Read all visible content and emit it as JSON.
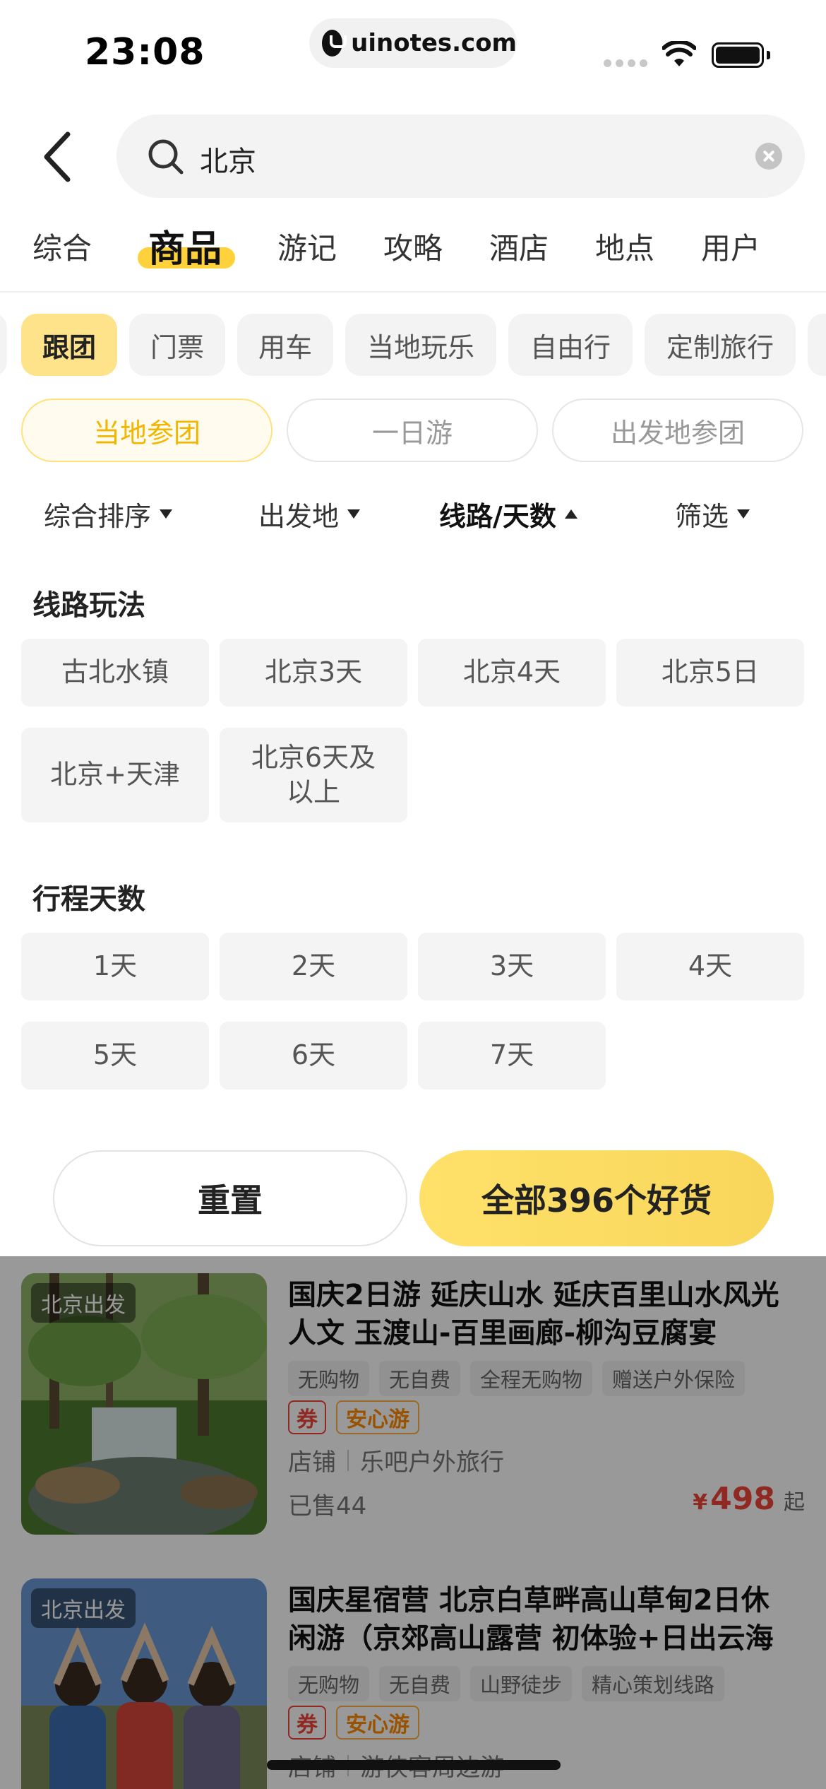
{
  "status_bar": {
    "time": "23:08",
    "url": "uinotes.com"
  },
  "search": {
    "value": "北京"
  },
  "tabs": [
    {
      "label": "综合"
    },
    {
      "label": "商品"
    },
    {
      "label": "游记"
    },
    {
      "label": "攻略"
    },
    {
      "label": "酒店"
    },
    {
      "label": "地点"
    },
    {
      "label": "用户"
    }
  ],
  "categories": [
    {
      "label": "跟团"
    },
    {
      "label": "门票"
    },
    {
      "label": "用车"
    },
    {
      "label": "当地玩乐"
    },
    {
      "label": "自由行"
    },
    {
      "label": "定制旅行"
    }
  ],
  "sub_filters": [
    {
      "label": "当地参团"
    },
    {
      "label": "一日游"
    },
    {
      "label": "出发地参团"
    }
  ],
  "sort": [
    {
      "label": "综合排序"
    },
    {
      "label": "出发地"
    },
    {
      "label": "线路/天数"
    },
    {
      "label": "筛选"
    }
  ],
  "route_section": {
    "title": "线路玩法",
    "options": [
      "古北水镇",
      "北京3天",
      "北京4天",
      "北京5日",
      "北京+天津",
      "北京6天及以上"
    ]
  },
  "days_section": {
    "title": "行程天数",
    "options": [
      "1天",
      "2天",
      "3天",
      "4天",
      "5天",
      "6天",
      "7天"
    ]
  },
  "buttons": {
    "reset": "重置",
    "confirm": "全部396个好货"
  },
  "products": [
    {
      "badge": "北京出发",
      "title": "国庆2日游 延庆山水 延庆百里山水风光人文 玉渡山-百里画廊-柳沟豆腐宴",
      "tags": [
        "无购物",
        "无自费",
        "全程无购物",
        "赠送户外保险"
      ],
      "coupon": "券",
      "safe": "安心游",
      "shop_label": "店铺",
      "shop_name": "乐吧户外旅行",
      "sold": "已售44",
      "currency": "¥",
      "price": "498",
      "price_suffix": "起"
    },
    {
      "badge": "北京出发",
      "title": "国庆星宿营 北京白草畔高山草甸2日休闲游（京郊高山露营 初体验+日出云海日…",
      "tags": [
        "无购物",
        "无自费",
        "山野徒步",
        "精心策划线路"
      ],
      "coupon": "券",
      "safe": "安心游",
      "shop_label": "店铺",
      "shop_name": "游侠客周边游"
    }
  ],
  "colors": {
    "accent_yellow": "#ffd23c",
    "price_red": "#f0453a",
    "safe_orange": "#ff8a00"
  }
}
